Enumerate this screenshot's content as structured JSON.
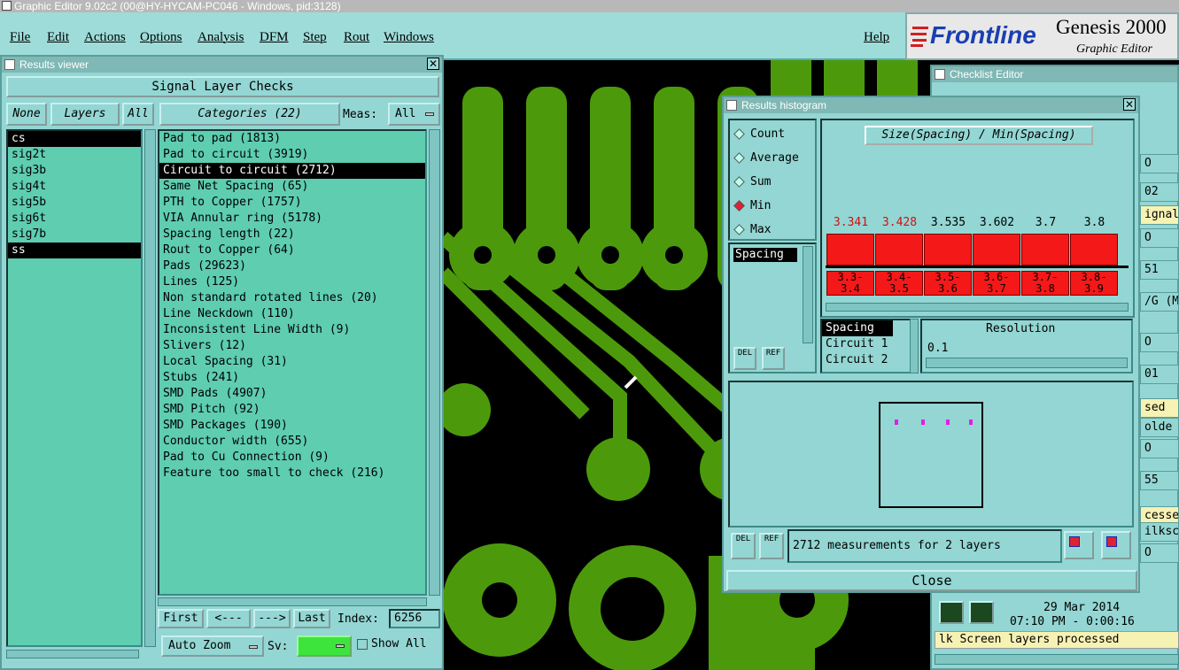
{
  "app": {
    "title": "Graphic Editor 9.02c2 (00@HY-HYCAM-PC046 - Windows, pid:3128)"
  },
  "menu": [
    "File",
    "Edit",
    "Actions",
    "Options",
    "Analysis",
    "DFM",
    "Step",
    "Rout",
    "Windows"
  ],
  "help_label": "Help",
  "logo": {
    "brand": "Frontline",
    "product": "Genesis 2000",
    "subtitle": "Graphic Editor"
  },
  "results_viewer": {
    "title": "Results viewer",
    "header": "Signal Layer Checks",
    "none_label": "None",
    "layers_label": "Layers",
    "all_label": "All",
    "categories_label": "Categories (22)",
    "meas_label": "Meas:",
    "meas_value": "All",
    "layers": [
      "cs",
      "sig2t",
      "sig3b",
      "sig4t",
      "sig5b",
      "sig6t",
      "sig7b",
      "ss"
    ],
    "selected_layers": [
      0,
      7
    ],
    "categories": [
      "Pad to pad (1813)",
      "Pad to circuit (3919)",
      "Circuit to circuit (2712)",
      "Same Net Spacing (65)",
      "PTH to Copper (1757)",
      "VIA Annular ring (5178)",
      "Spacing length (22)",
      "Rout to Copper (64)",
      "Pads (29623)",
      "Lines (125)",
      "Non standard rotated lines (20)",
      "Line Neckdown (110)",
      "Inconsistent Line Width (9)",
      "Slivers (12)",
      "Local Spacing (31)",
      "Stubs (241)",
      "SMD Pads (4907)",
      "SMD Pitch (92)",
      "SMD Packages (190)",
      "Conductor width (655)",
      "Pad to Cu Connection (9)",
      "Feature too small to check (216)"
    ],
    "selected_category": 2,
    "first_label": "First",
    "prev_label": "<---",
    "next_label": "--->",
    "last_label": "Last",
    "index_label": "Index:",
    "index_value": "6256",
    "auto_zoom_label": "Auto Zoom",
    "sv_label": "Sv:",
    "show_all_label": "Show All"
  },
  "histogram": {
    "title": "Results histogram",
    "options": [
      "Count",
      "Average",
      "Sum",
      "Min",
      "Max"
    ],
    "selected_option": 3,
    "chart_title": "Size(Spacing) / Min(Spacing)",
    "field_list": [
      "Spacing"
    ],
    "bars": [
      {
        "label": "3.341",
        "bin": "3.3-\n3.4",
        "red": true
      },
      {
        "label": "3.428",
        "bin": "3.4-\n3.5",
        "red": true
      },
      {
        "label": "3.535",
        "bin": "3.5-\n3.6",
        "red": false
      },
      {
        "label": "3.602",
        "bin": "3.6-\n3.7",
        "red": false
      },
      {
        "label": "3.7",
        "bin": "3.7-\n3.8",
        "red": false
      },
      {
        "label": "3.8",
        "bin": "3.8-\n3.9",
        "red": false
      }
    ],
    "attr_list": [
      "Spacing",
      "Circuit 1",
      "Circuit 2"
    ],
    "resolution_label": "Resolution",
    "resolution_value": "0.1",
    "del_label": "DEL",
    "ref_label": "REF",
    "status": "2712 measurements for 2 layers",
    "close_label": "Close"
  },
  "checklist": {
    "title": "Checklist Editor",
    "right_fragments": [
      "O",
      "02",
      "ignal",
      "O",
      "51",
      "/G (M",
      "O",
      "01",
      "sed",
      "olde",
      "O",
      "55",
      "cesse",
      "ilksc",
      "O"
    ],
    "date": "29 Mar 2014",
    "time": "07:10 PM - 0:00:16",
    "status": "lk Screen layers processed"
  },
  "colors": {
    "panel": "#93d6d3",
    "list": "#5ecdb0",
    "copper": "#4c9a0c",
    "bar_red": "#f41818",
    "sv_green": "#3ce43c"
  }
}
